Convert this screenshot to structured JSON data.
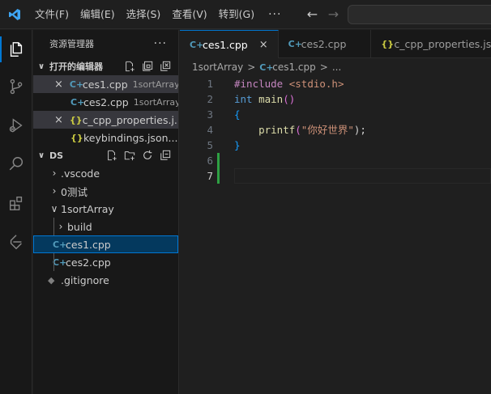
{
  "menu": {
    "items": [
      "文件(F)",
      "编辑(E)",
      "选择(S)",
      "查看(V)",
      "转到(G)"
    ],
    "more": "···"
  },
  "icons": {
    "logo": "vscode-logo-icon",
    "back": "arrow-left-icon",
    "forward": "arrow-right-icon"
  },
  "sidebar": {
    "title": "资源管理器",
    "more": "···",
    "open_editors": {
      "label": "打开的编辑器",
      "items": [
        {
          "name": "ces1.cpp",
          "desc": "1sortArray"
        },
        {
          "name": "ces2.cpp",
          "desc": "1sortArray"
        },
        {
          "name": "c_cpp_properties.j..."
        },
        {
          "name": "keybindings.json..."
        }
      ]
    },
    "workspace": {
      "label": "DS",
      "items": [
        {
          "name": ".vscode"
        },
        {
          "name": "0测试"
        },
        {
          "name": "1sortArray"
        },
        {
          "name": "build"
        },
        {
          "name": "ces1.cpp"
        },
        {
          "name": "ces2.cpp"
        },
        {
          "name": ".gitignore"
        }
      ]
    }
  },
  "tabs": [
    {
      "label": "ces1.cpp",
      "close": "×"
    },
    {
      "label": "ces2.cpp"
    },
    {
      "label": "c_cpp_properties.json"
    }
  ],
  "breadcrumb": {
    "folder": "1sortArray",
    "file": "ces1.cpp",
    "sep": ">",
    "tail": "..."
  },
  "file_icons": {
    "cpp": "C+",
    "json": "{}",
    "git": "◆"
  },
  "editor": {
    "line_numbers": [
      "1",
      "2",
      "3",
      "4",
      "5",
      "6",
      "7"
    ],
    "line1_directive": "#include",
    "line1_header": "<stdio.h>",
    "line2_type": "int",
    "line2_name": "main",
    "line2_parens": "()",
    "line3_brace": "{",
    "line4_fn": "printf",
    "line4_open": "(",
    "line4_str": "\"你好世界\"",
    "line4_close": ");",
    "line5_brace": "}"
  },
  "colors": {
    "accent": "#0078d4",
    "added_line": "#2ea043"
  }
}
